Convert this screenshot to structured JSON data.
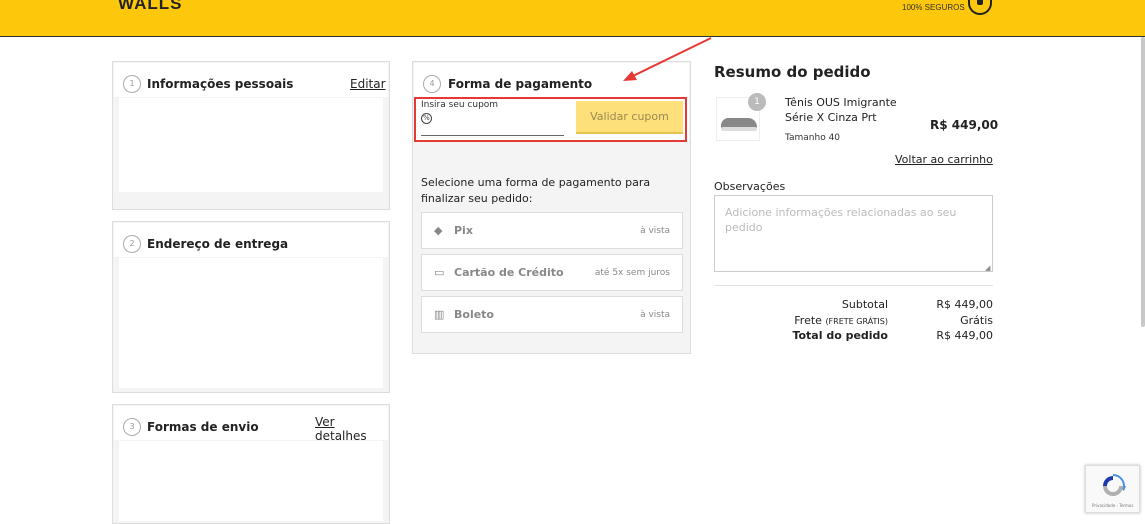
{
  "header": {
    "logo": "WALLS",
    "secure_line": "100% SEGUROS"
  },
  "sections": {
    "personal": {
      "step": "1",
      "title": "Informações pessoais",
      "link": "Editar"
    },
    "address": {
      "step": "2",
      "title": "Endereço de entrega"
    },
    "shipping": {
      "step": "3",
      "title": "Formas de envio",
      "link": "Ver detalhes"
    },
    "payment": {
      "step": "4",
      "title": "Forma de pagamento",
      "coupon_label": "Insira seu cupom",
      "coupon_value": "",
      "coupon_button": "Validar cupom",
      "select_message": "Selecione uma forma de pagamento para finalizar seu pedido:",
      "options": [
        {
          "icon": "pix-icon",
          "label": "Pix",
          "note": "à vista"
        },
        {
          "icon": "credit-card-icon",
          "label": "Cartão de Crédito",
          "note": "até 5x sem juros"
        },
        {
          "icon": "barcode-icon",
          "label": "Boleto",
          "note": "à vista"
        }
      ]
    }
  },
  "summary": {
    "title": "Resumo do pedido",
    "item": {
      "quantity": "1",
      "name": "Tênis OUS Imigrante Série X Cinza Prt",
      "size": "Tamanho 40",
      "price": "R$ 449,00"
    },
    "back_link": "Voltar ao carrinho",
    "notes_label": "Observações",
    "notes_placeholder": "Adicione informações relacionadas ao seu pedido",
    "subtotal_label": "Subtotal",
    "subtotal_value": "R$ 449,00",
    "shipping_label": "Frete",
    "shipping_note": "(FRETE GRÁTIS)",
    "shipping_value": "Grátis",
    "total_label": "Total do pedido",
    "total_value": "R$ 449,00"
  },
  "recaptcha": {
    "text": "Privacidade - Termos"
  },
  "colors": {
    "brand": "#fdc80c",
    "highlight": "#e53935"
  }
}
